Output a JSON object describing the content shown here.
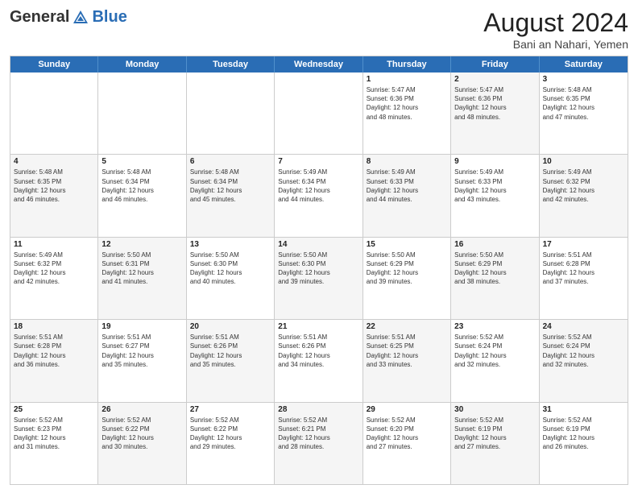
{
  "logo": {
    "general": "General",
    "blue": "Blue"
  },
  "title": {
    "month_year": "August 2024",
    "location": "Bani an Nahari, Yemen"
  },
  "header_days": [
    "Sunday",
    "Monday",
    "Tuesday",
    "Wednesday",
    "Thursday",
    "Friday",
    "Saturday"
  ],
  "weeks": [
    [
      {
        "day": "",
        "info": "",
        "shaded": false,
        "empty": true
      },
      {
        "day": "",
        "info": "",
        "shaded": false,
        "empty": true
      },
      {
        "day": "",
        "info": "",
        "shaded": false,
        "empty": true
      },
      {
        "day": "",
        "info": "",
        "shaded": false,
        "empty": true
      },
      {
        "day": "1",
        "info": "Sunrise: 5:47 AM\nSunset: 6:36 PM\nDaylight: 12 hours\nand 48 minutes.",
        "shaded": false,
        "empty": false
      },
      {
        "day": "2",
        "info": "Sunrise: 5:47 AM\nSunset: 6:36 PM\nDaylight: 12 hours\nand 48 minutes.",
        "shaded": true,
        "empty": false
      },
      {
        "day": "3",
        "info": "Sunrise: 5:48 AM\nSunset: 6:35 PM\nDaylight: 12 hours\nand 47 minutes.",
        "shaded": false,
        "empty": false
      }
    ],
    [
      {
        "day": "4",
        "info": "Sunrise: 5:48 AM\nSunset: 6:35 PM\nDaylight: 12 hours\nand 46 minutes.",
        "shaded": true,
        "empty": false
      },
      {
        "day": "5",
        "info": "Sunrise: 5:48 AM\nSunset: 6:34 PM\nDaylight: 12 hours\nand 46 minutes.",
        "shaded": false,
        "empty": false
      },
      {
        "day": "6",
        "info": "Sunrise: 5:48 AM\nSunset: 6:34 PM\nDaylight: 12 hours\nand 45 minutes.",
        "shaded": true,
        "empty": false
      },
      {
        "day": "7",
        "info": "Sunrise: 5:49 AM\nSunset: 6:34 PM\nDaylight: 12 hours\nand 44 minutes.",
        "shaded": false,
        "empty": false
      },
      {
        "day": "8",
        "info": "Sunrise: 5:49 AM\nSunset: 6:33 PM\nDaylight: 12 hours\nand 44 minutes.",
        "shaded": true,
        "empty": false
      },
      {
        "day": "9",
        "info": "Sunrise: 5:49 AM\nSunset: 6:33 PM\nDaylight: 12 hours\nand 43 minutes.",
        "shaded": false,
        "empty": false
      },
      {
        "day": "10",
        "info": "Sunrise: 5:49 AM\nSunset: 6:32 PM\nDaylight: 12 hours\nand 42 minutes.",
        "shaded": true,
        "empty": false
      }
    ],
    [
      {
        "day": "11",
        "info": "Sunrise: 5:49 AM\nSunset: 6:32 PM\nDaylight: 12 hours\nand 42 minutes.",
        "shaded": false,
        "empty": false
      },
      {
        "day": "12",
        "info": "Sunrise: 5:50 AM\nSunset: 6:31 PM\nDaylight: 12 hours\nand 41 minutes.",
        "shaded": true,
        "empty": false
      },
      {
        "day": "13",
        "info": "Sunrise: 5:50 AM\nSunset: 6:30 PM\nDaylight: 12 hours\nand 40 minutes.",
        "shaded": false,
        "empty": false
      },
      {
        "day": "14",
        "info": "Sunrise: 5:50 AM\nSunset: 6:30 PM\nDaylight: 12 hours\nand 39 minutes.",
        "shaded": true,
        "empty": false
      },
      {
        "day": "15",
        "info": "Sunrise: 5:50 AM\nSunset: 6:29 PM\nDaylight: 12 hours\nand 39 minutes.",
        "shaded": false,
        "empty": false
      },
      {
        "day": "16",
        "info": "Sunrise: 5:50 AM\nSunset: 6:29 PM\nDaylight: 12 hours\nand 38 minutes.",
        "shaded": true,
        "empty": false
      },
      {
        "day": "17",
        "info": "Sunrise: 5:51 AM\nSunset: 6:28 PM\nDaylight: 12 hours\nand 37 minutes.",
        "shaded": false,
        "empty": false
      }
    ],
    [
      {
        "day": "18",
        "info": "Sunrise: 5:51 AM\nSunset: 6:28 PM\nDaylight: 12 hours\nand 36 minutes.",
        "shaded": true,
        "empty": false
      },
      {
        "day": "19",
        "info": "Sunrise: 5:51 AM\nSunset: 6:27 PM\nDaylight: 12 hours\nand 35 minutes.",
        "shaded": false,
        "empty": false
      },
      {
        "day": "20",
        "info": "Sunrise: 5:51 AM\nSunset: 6:26 PM\nDaylight: 12 hours\nand 35 minutes.",
        "shaded": true,
        "empty": false
      },
      {
        "day": "21",
        "info": "Sunrise: 5:51 AM\nSunset: 6:26 PM\nDaylight: 12 hours\nand 34 minutes.",
        "shaded": false,
        "empty": false
      },
      {
        "day": "22",
        "info": "Sunrise: 5:51 AM\nSunset: 6:25 PM\nDaylight: 12 hours\nand 33 minutes.",
        "shaded": true,
        "empty": false
      },
      {
        "day": "23",
        "info": "Sunrise: 5:52 AM\nSunset: 6:24 PM\nDaylight: 12 hours\nand 32 minutes.",
        "shaded": false,
        "empty": false
      },
      {
        "day": "24",
        "info": "Sunrise: 5:52 AM\nSunset: 6:24 PM\nDaylight: 12 hours\nand 32 minutes.",
        "shaded": true,
        "empty": false
      }
    ],
    [
      {
        "day": "25",
        "info": "Sunrise: 5:52 AM\nSunset: 6:23 PM\nDaylight: 12 hours\nand 31 minutes.",
        "shaded": false,
        "empty": false
      },
      {
        "day": "26",
        "info": "Sunrise: 5:52 AM\nSunset: 6:22 PM\nDaylight: 12 hours\nand 30 minutes.",
        "shaded": true,
        "empty": false
      },
      {
        "day": "27",
        "info": "Sunrise: 5:52 AM\nSunset: 6:22 PM\nDaylight: 12 hours\nand 29 minutes.",
        "shaded": false,
        "empty": false
      },
      {
        "day": "28",
        "info": "Sunrise: 5:52 AM\nSunset: 6:21 PM\nDaylight: 12 hours\nand 28 minutes.",
        "shaded": true,
        "empty": false
      },
      {
        "day": "29",
        "info": "Sunrise: 5:52 AM\nSunset: 6:20 PM\nDaylight: 12 hours\nand 27 minutes.",
        "shaded": false,
        "empty": false
      },
      {
        "day": "30",
        "info": "Sunrise: 5:52 AM\nSunset: 6:19 PM\nDaylight: 12 hours\nand 27 minutes.",
        "shaded": true,
        "empty": false
      },
      {
        "day": "31",
        "info": "Sunrise: 5:52 AM\nSunset: 6:19 PM\nDaylight: 12 hours\nand 26 minutes.",
        "shaded": false,
        "empty": false
      }
    ]
  ]
}
